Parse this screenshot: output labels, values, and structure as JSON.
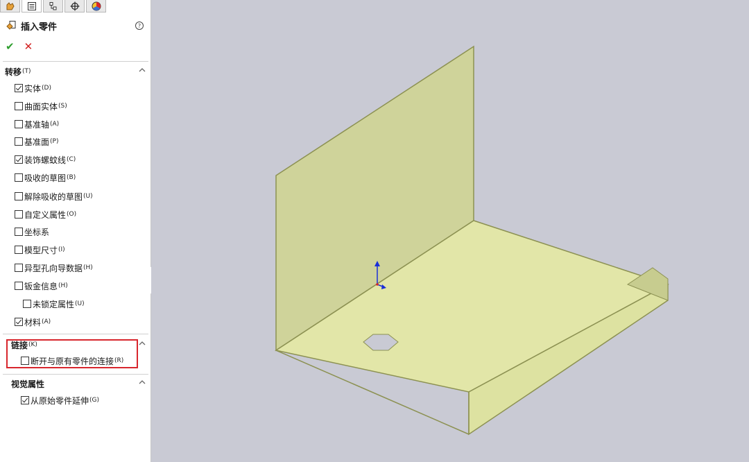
{
  "panel": {
    "tabs": [
      {
        "icon": "feature-manager-icon"
      },
      {
        "icon": "property-manager-icon"
      },
      {
        "icon": "configuration-manager-icon"
      },
      {
        "icon": "dimxpert-manager-icon"
      },
      {
        "icon": "display-manager-icon"
      }
    ],
    "title": "插入零件",
    "sections": {
      "transfer": {
        "label": "转移",
        "hotkey": "(T)",
        "items": [
          {
            "label": "实体",
            "hotkey": "(D)",
            "checked": true
          },
          {
            "label": "曲面实体",
            "hotkey": "(S)",
            "checked": false
          },
          {
            "label": "基准轴",
            "hotkey": "(A)",
            "checked": false
          },
          {
            "label": "基准面",
            "hotkey": "(P)",
            "checked": false
          },
          {
            "label": "装饰螺蚊线",
            "hotkey": "(C)",
            "checked": true
          },
          {
            "label": "吸收的草图",
            "hotkey": "(B)",
            "checked": false
          },
          {
            "label": "解除吸收的草图",
            "hotkey": "(U)",
            "checked": false
          },
          {
            "label": "自定义属性",
            "hotkey": "(O)",
            "checked": false
          },
          {
            "label": "坐标系",
            "hotkey": "",
            "checked": false
          },
          {
            "label": "模型尺寸",
            "hotkey": "(I)",
            "checked": false
          },
          {
            "label": "异型孔向导数据",
            "hotkey": "(H)",
            "checked": false
          },
          {
            "label": "钣金信息",
            "hotkey": "(H)",
            "checked": false
          },
          {
            "label": "未锁定属性",
            "hotkey": "(U)",
            "checked": false
          },
          {
            "label": "材料",
            "hotkey": "(A)",
            "checked": true
          }
        ]
      },
      "link": {
        "label": "链接",
        "hotkey": "(K)",
        "items": [
          {
            "label": "断开与原有零件的连接",
            "hotkey": "(R)",
            "checked": false
          }
        ]
      },
      "visual": {
        "label": "视觉属性",
        "items": [
          {
            "label": "从原始零件延伸",
            "hotkey": "(G)",
            "checked": true
          }
        ]
      }
    }
  },
  "colors": {
    "viewport_bg": "#c9cad4",
    "part_face": "#e2e6a8",
    "part_edge": "#8c9152",
    "highlight": "#d8262d",
    "ok": "#2e9e2e",
    "cancel": "#d22222"
  }
}
